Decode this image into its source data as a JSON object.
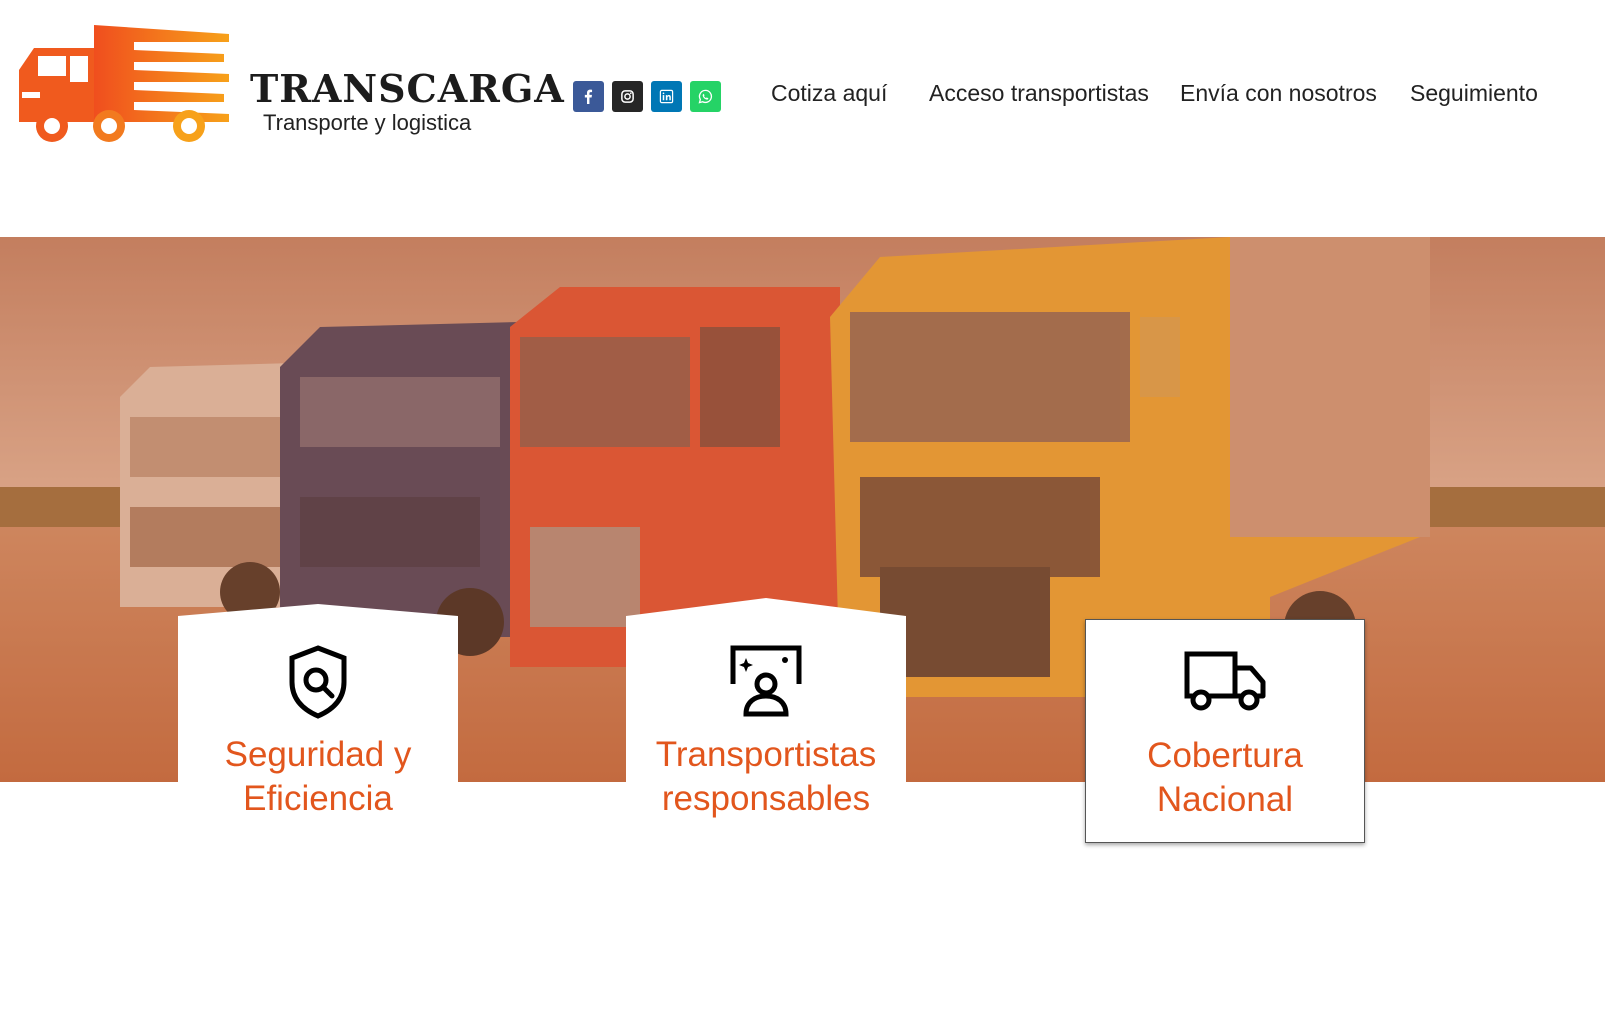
{
  "brand": {
    "name": "TRANSCARGA",
    "tagline": "Transporte y logistica",
    "color": "#f26c1c"
  },
  "social": [
    {
      "icon": "facebook-icon",
      "color": "#3b5998"
    },
    {
      "icon": "instagram-icon",
      "color": "#262626"
    },
    {
      "icon": "linkedin-icon",
      "color": "#0077b5"
    },
    {
      "icon": "whatsapp-icon",
      "color": "#25d366"
    }
  ],
  "nav": {
    "items": [
      {
        "label": "Cotiza aquí"
      },
      {
        "label": "Acceso transportistas"
      },
      {
        "label": "Envía con nosotros"
      },
      {
        "label": "Seguimiento"
      }
    ]
  },
  "hero": {
    "overlay_color": "#e07a45"
  },
  "features": [
    {
      "title_line1": "Seguridad y",
      "title_line2": "Eficiencia",
      "icon": "shield-search-icon"
    },
    {
      "title_line1": "Transportistas",
      "title_line2": "responsables",
      "icon": "person-screen-icon"
    },
    {
      "title_line1": "Cobertura",
      "title_line2": "Nacional",
      "icon": "delivery-truck-icon"
    }
  ]
}
